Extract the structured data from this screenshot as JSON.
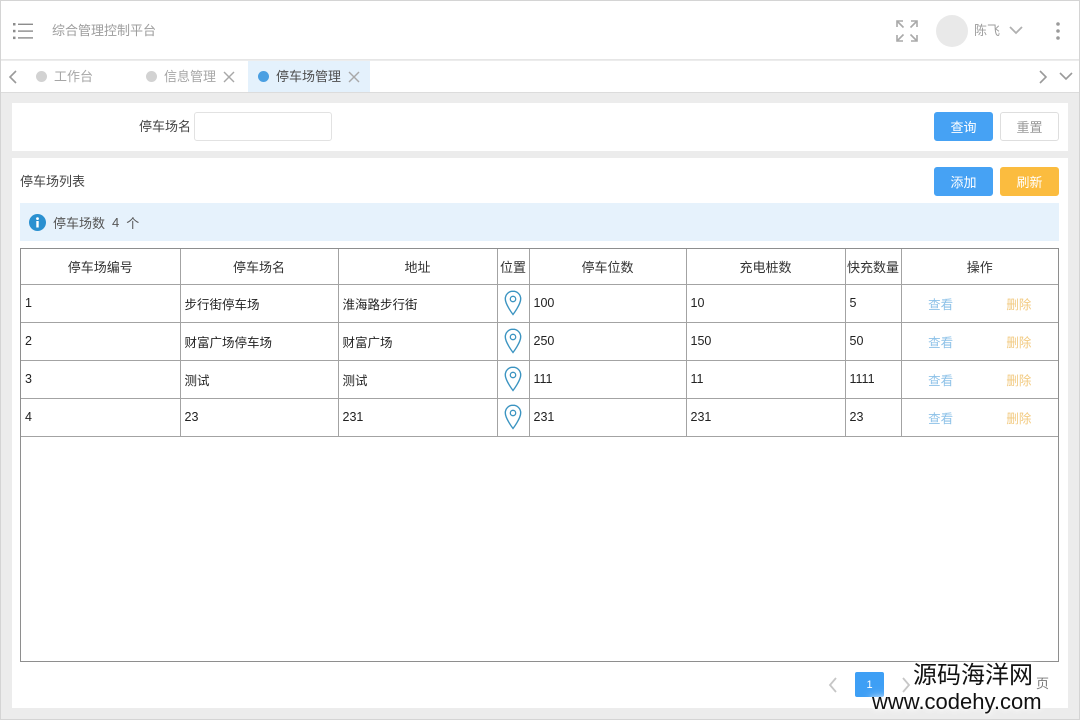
{
  "header": {
    "title": "综合管理控制平台",
    "user_name": "陈飞",
    "icons": {
      "menu": "menu-icon",
      "fullscreen": "fullscreen-icon",
      "avatar": "avatar",
      "user_menu": "chevron-down-icon",
      "more": "more-vertical-icon"
    }
  },
  "tabs": {
    "items": [
      {
        "label": "工作台",
        "active": false,
        "closable": false
      },
      {
        "label": "信息管理",
        "active": false,
        "closable": true
      },
      {
        "label": "停车场管理",
        "active": true,
        "closable": true
      }
    ],
    "icons": {
      "prev": "chevron-left-icon",
      "next": "chevron-right-icon",
      "menu": "chevron-down-icon",
      "close": "close-icon"
    }
  },
  "search": {
    "field_label": "停车场名",
    "field_value": "",
    "query_label": "查询",
    "reset_label": "重置"
  },
  "list": {
    "title": "停车场列表",
    "add_label": "添加",
    "refresh_label": "刷新",
    "summary": {
      "label": "停车场数",
      "count": 4,
      "unit": "个",
      "icon": "info-icon"
    },
    "columns": [
      "停车场编号",
      "停车场名",
      "地址",
      "位置",
      "停车位数",
      "充电桩数",
      "快充数量",
      "操作"
    ],
    "rows": [
      {
        "id": 1,
        "name": "步行街停车场",
        "address": "淮海路步行街",
        "location_icon": "map-pin-icon",
        "spaces": 100,
        "chargers": 10,
        "fast_chargers": 5
      },
      {
        "id": 2,
        "name": "财富广场停车场",
        "address": "财富广场",
        "location_icon": "map-pin-icon",
        "spaces": 250,
        "chargers": 150,
        "fast_chargers": 50
      },
      {
        "id": 3,
        "name": "测试",
        "address": "测试",
        "location_icon": "map-pin-icon",
        "spaces": 111,
        "chargers": 11,
        "fast_chargers": 1111
      },
      {
        "id": 4,
        "name": "23",
        "address": "231",
        "location_icon": "map-pin-icon",
        "spaces": 231,
        "chargers": 231,
        "fast_chargers": 23
      }
    ],
    "row_actions": {
      "view": "查看",
      "delete": "删除"
    }
  },
  "pagination": {
    "current_page": 1,
    "suffix": "页",
    "icons": {
      "prev": "chevron-left-icon",
      "next": "chevron-right-icon"
    }
  },
  "watermark": {
    "name": "源码海洋网",
    "url": "www.codehy.com"
  },
  "colors": {
    "primary": "#46a2f4",
    "warning": "#fbbc3f",
    "view_link": "#8ec2e8",
    "delete_link": "#f2ca80",
    "map_pin": "#3b94c1",
    "info_icon": "#2a90d0",
    "info_bar_bg": "#e6f2fc",
    "active_tab_bg": "#e4f1fc",
    "active_tab_dot": "#4a9fe2"
  }
}
